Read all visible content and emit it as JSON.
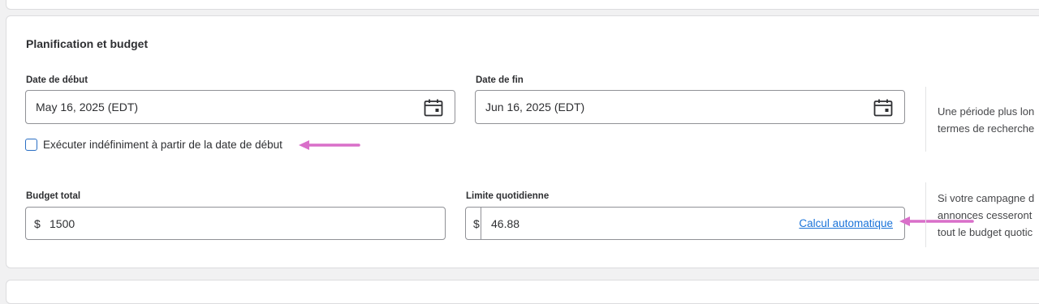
{
  "section": {
    "title": "Planification et budget"
  },
  "start_date": {
    "label": "Date de début",
    "value": "May 16, 2025 (EDT)",
    "icon": "calendar-icon"
  },
  "end_date": {
    "label": "Date de fin",
    "value": "Jun 16, 2025 (EDT)",
    "icon": "calendar-icon"
  },
  "run_indefinitely": {
    "label": "Exécuter indéfiniment à partir de la date de début",
    "checked": false
  },
  "schedule_helper": {
    "line1": "Une période plus lon",
    "line2": "termes de recherche"
  },
  "total_budget": {
    "label": "Budget total",
    "currency": "$",
    "value": "1500"
  },
  "daily_limit": {
    "label": "Limite quotidienne",
    "currency": "$",
    "value": "46.88",
    "auto_calc_link": "Calcul automatique"
  },
  "budget_helper": {
    "line1": "Si votre campagne d",
    "line2": "annonces cesseront",
    "line3": "tout le budget quotic"
  },
  "colors": {
    "annotation_arrow": "#d96fc9",
    "link": "#1a73d9",
    "checkbox_border": "#2a6fc4"
  }
}
